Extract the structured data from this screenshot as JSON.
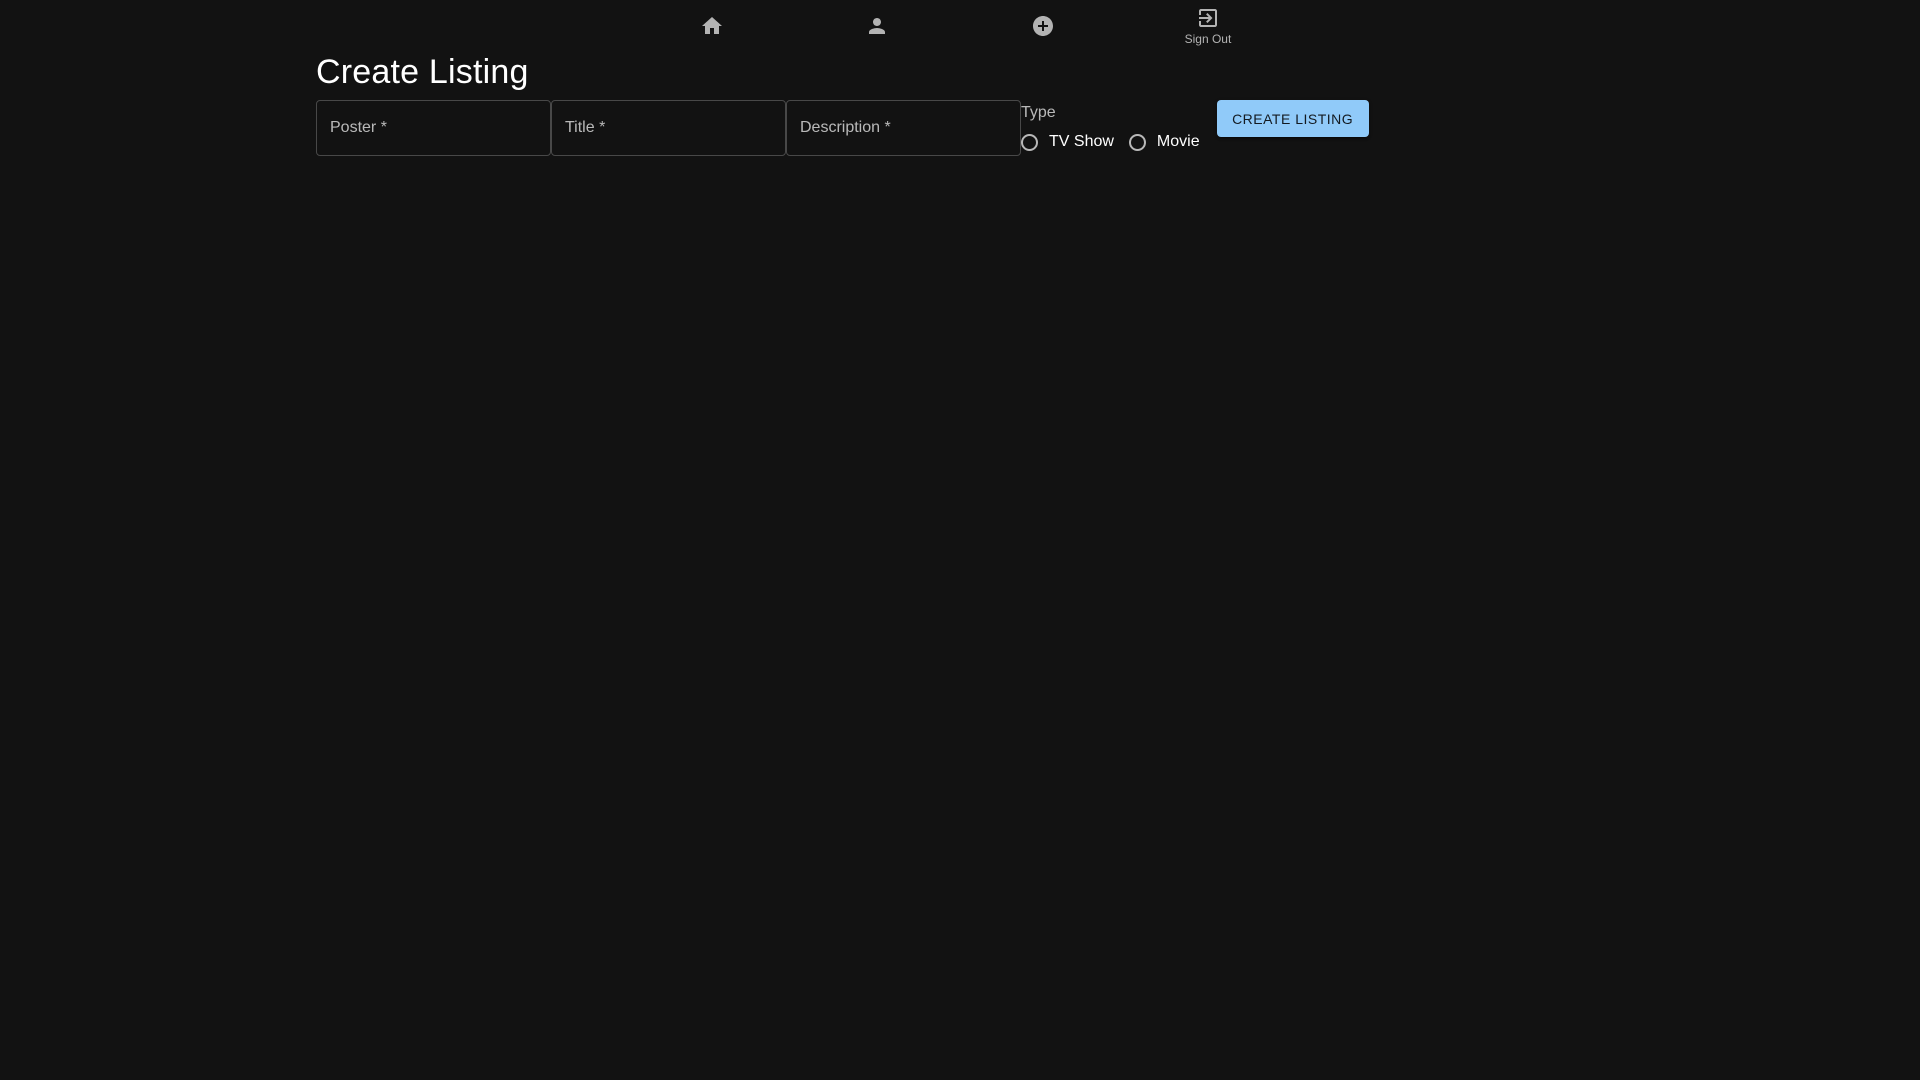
{
  "nav": {
    "items": [
      {
        "icon": "home-icon"
      },
      {
        "icon": "person-icon"
      },
      {
        "icon": "add-circle-icon"
      },
      {
        "icon": "sign-out-icon",
        "label": "Sign Out"
      }
    ]
  },
  "page": {
    "title": "Create Listing"
  },
  "form": {
    "poster": {
      "label": "Poster *",
      "value": ""
    },
    "title": {
      "label": "Title *",
      "value": ""
    },
    "description": {
      "label": "Description *",
      "value": ""
    },
    "type": {
      "legend": "Type",
      "options": [
        {
          "label": "TV Show",
          "selected": false
        },
        {
          "label": "Movie",
          "selected": false
        }
      ]
    },
    "submit_label": "CREATE LISTING"
  },
  "colors": {
    "background": "#121212",
    "accent": "#90caf9",
    "icon": "#b3b3b3"
  }
}
